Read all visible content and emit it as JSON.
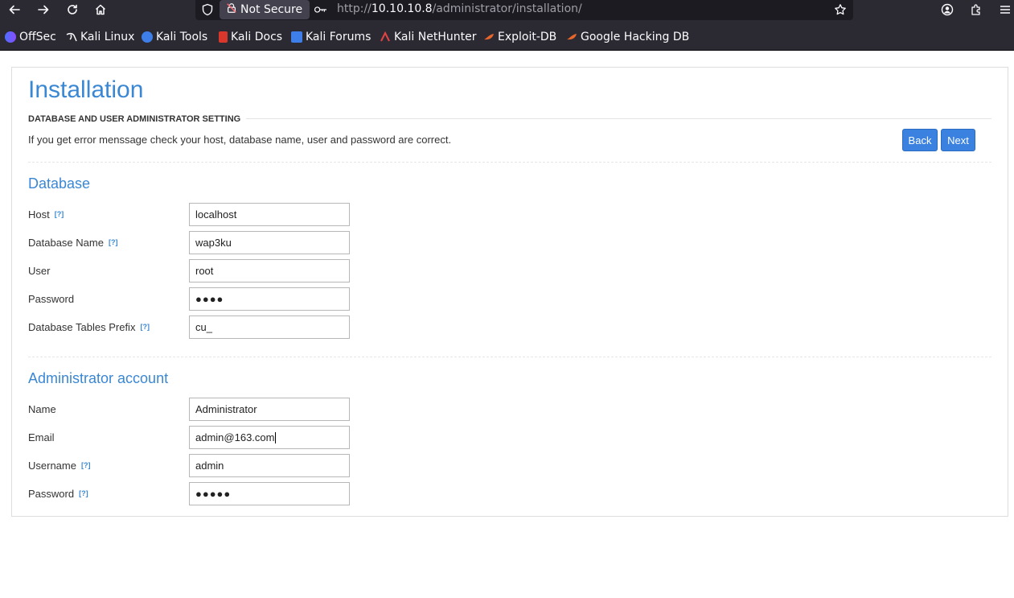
{
  "browser": {
    "not_secure_label": "Not Secure",
    "url_prefix": "http://",
    "url_host": "10.10.10.8",
    "url_path": "/administrator/installation/",
    "bookmarks": [
      {
        "label": "OffSec",
        "icon": "offsec-icon"
      },
      {
        "label": "Kali Linux",
        "icon": "kali-dragon-icon"
      },
      {
        "label": "Kali Tools",
        "icon": "kali-tools-icon"
      },
      {
        "label": "Kali Docs",
        "icon": "kali-docs-icon"
      },
      {
        "label": "Kali Forums",
        "icon": "kali-forums-icon"
      },
      {
        "label": "Kali NetHunter",
        "icon": "nethunter-icon"
      },
      {
        "label": "Exploit-DB",
        "icon": "exploit-db-icon"
      },
      {
        "label": "Google Hacking DB",
        "icon": "ghdb-icon"
      }
    ]
  },
  "page": {
    "title": "Installation",
    "section_heading": "DATABASE AND USER ADMINISTRATOR SETTING",
    "info": "If you get error menssage check your host, database name, user and password are correct.",
    "back_label": "Back",
    "next_label": "Next",
    "help_marker": "[?]"
  },
  "database": {
    "title": "Database",
    "host_label": "Host",
    "host_value": "localhost",
    "dbname_label": "Database Name",
    "dbname_value": "wap3ku",
    "user_label": "User",
    "user_value": "root",
    "password_label": "Password",
    "password_value": "●●●●",
    "prefix_label": "Database Tables Prefix",
    "prefix_value": "cu_"
  },
  "admin": {
    "title": "Administrator account",
    "name_label": "Name",
    "name_value": "Administrator",
    "email_label": "Email",
    "email_value": "admin@163.com",
    "username_label": "Username",
    "username_value": "admin",
    "password_label": "Password",
    "password_value": "●●●●●"
  },
  "colors": {
    "accent": "#3a87d4",
    "button": "#3b82e0",
    "chrome": "#2b2a33"
  }
}
